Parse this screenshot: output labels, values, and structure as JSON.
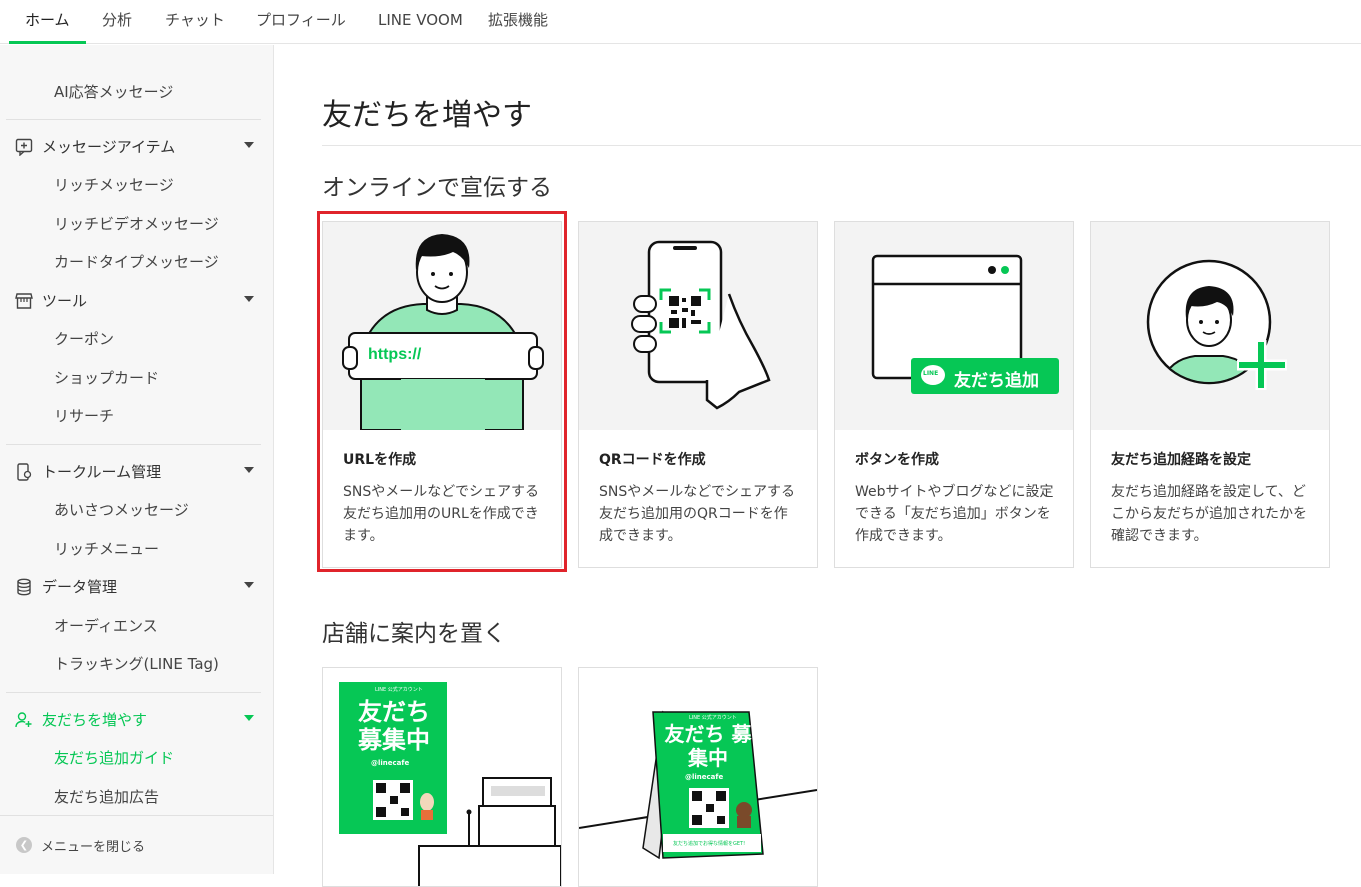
{
  "topnav": {
    "tabs": [
      "ホーム",
      "分析",
      "チャット",
      "プロフィール",
      "LINE VOOM",
      "拡張機能"
    ]
  },
  "sidebar": {
    "ai_reply": "AI応答メッセージ",
    "message_items": {
      "label": "メッセージアイテム",
      "items": [
        "リッチメッセージ",
        "リッチビデオメッセージ",
        "カードタイプメッセージ"
      ]
    },
    "tools": {
      "label": "ツール",
      "items": [
        "クーポン",
        "ショップカード",
        "リサーチ"
      ]
    },
    "talkroom": {
      "label": "トークルーム管理",
      "items": [
        "あいさつメッセージ",
        "リッチメニュー"
      ]
    },
    "data_mgmt": {
      "label": "データ管理",
      "items": [
        "オーディエンス",
        "トラッキング(LINE Tag)"
      ]
    },
    "friends": {
      "label": "友だちを増やす",
      "items": [
        "友だち追加ガイド",
        "友だち追加広告"
      ]
    },
    "close_menu": "メニューを閉じる"
  },
  "main": {
    "title": "友だちを増やす",
    "section_online": "オンラインで宣伝する",
    "cards": [
      {
        "title": "URLを作成",
        "desc": "SNSやメールなどでシェアする友だち追加用のURLを作成できます。",
        "art_text": "https://"
      },
      {
        "title": "QRコードを作成",
        "desc": "SNSやメールなどでシェアする友だち追加用のQRコードを作成できます。"
      },
      {
        "title": "ボタンを作成",
        "desc": "Webサイトやブログなどに設定できる「友だち追加」ボタンを作成できます。",
        "art_text": "友だち追加",
        "art_badge": "LINE"
      },
      {
        "title": "友だち追加経路を設定",
        "desc": "友だち追加経路を設定して、どこから友だちが追加されたかを確認できます。"
      }
    ],
    "section_store": "店舗に案内を置く",
    "store_cards": [
      {
        "poster_title": "友だち 募集中",
        "poster_handle": "@linecafe",
        "poster_top": "LINE 公式アカウント"
      },
      {
        "poster_title": "友だち 募集中",
        "poster_handle": "@linecafe",
        "poster_top": "LINE 公式アカウント",
        "poster_footer": "友だち追加でお得な情報をGET!"
      }
    ]
  },
  "colors": {
    "accent": "#06c755",
    "highlight": "#e0242b"
  }
}
